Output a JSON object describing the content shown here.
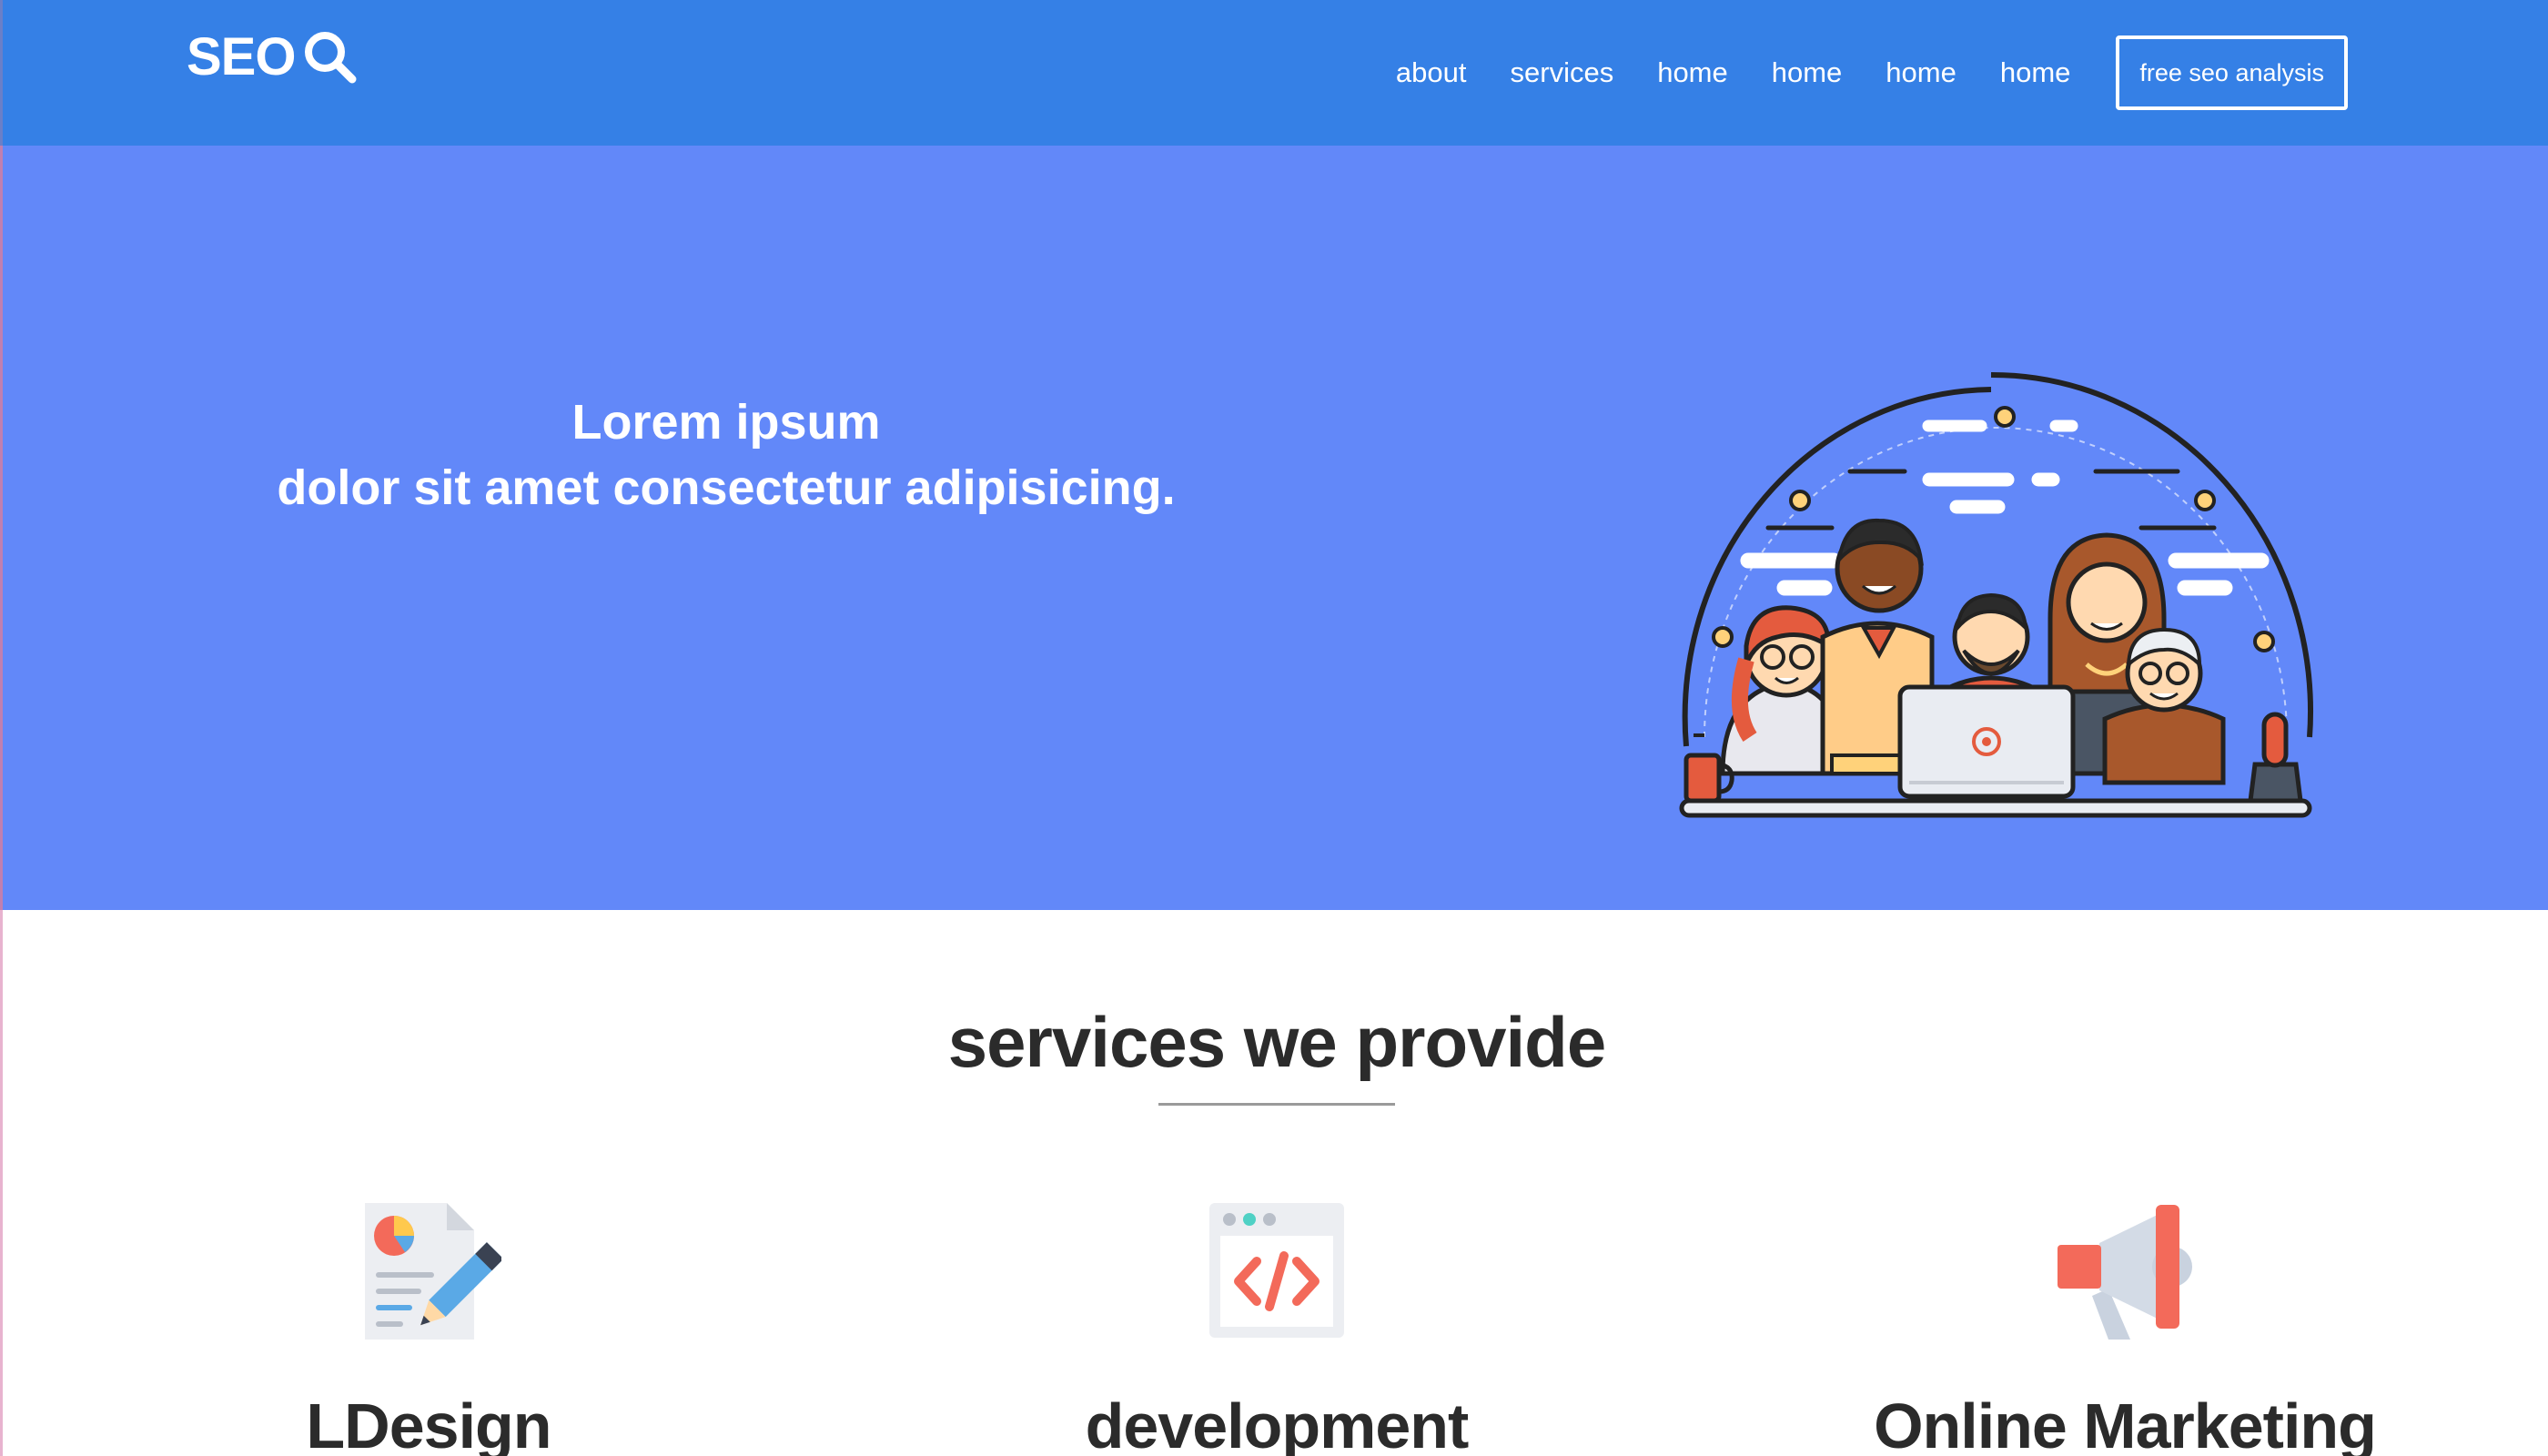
{
  "nav": {
    "logo_text": "SEO",
    "logo_icon": "search-icon",
    "links": [
      "about",
      "services",
      "home",
      "home",
      "home",
      "home"
    ],
    "cta_label": "free seo analysis"
  },
  "hero": {
    "line1": "Lorem ipsum",
    "line2": "dolor sit amet consectetur adipisicing.",
    "illustration": "team-illustration"
  },
  "services": {
    "title": "services we provide",
    "items": [
      {
        "icon": "design-document-pencil-icon",
        "label": "LDesign"
      },
      {
        "icon": "code-window-icon",
        "label": "development"
      },
      {
        "icon": "megaphone-icon",
        "label": "Online Marketing"
      }
    ]
  },
  "colors": {
    "nav_bg": "#3580e6",
    "hero_bg": "#6288f9",
    "text_dark": "#2b2b2b"
  }
}
